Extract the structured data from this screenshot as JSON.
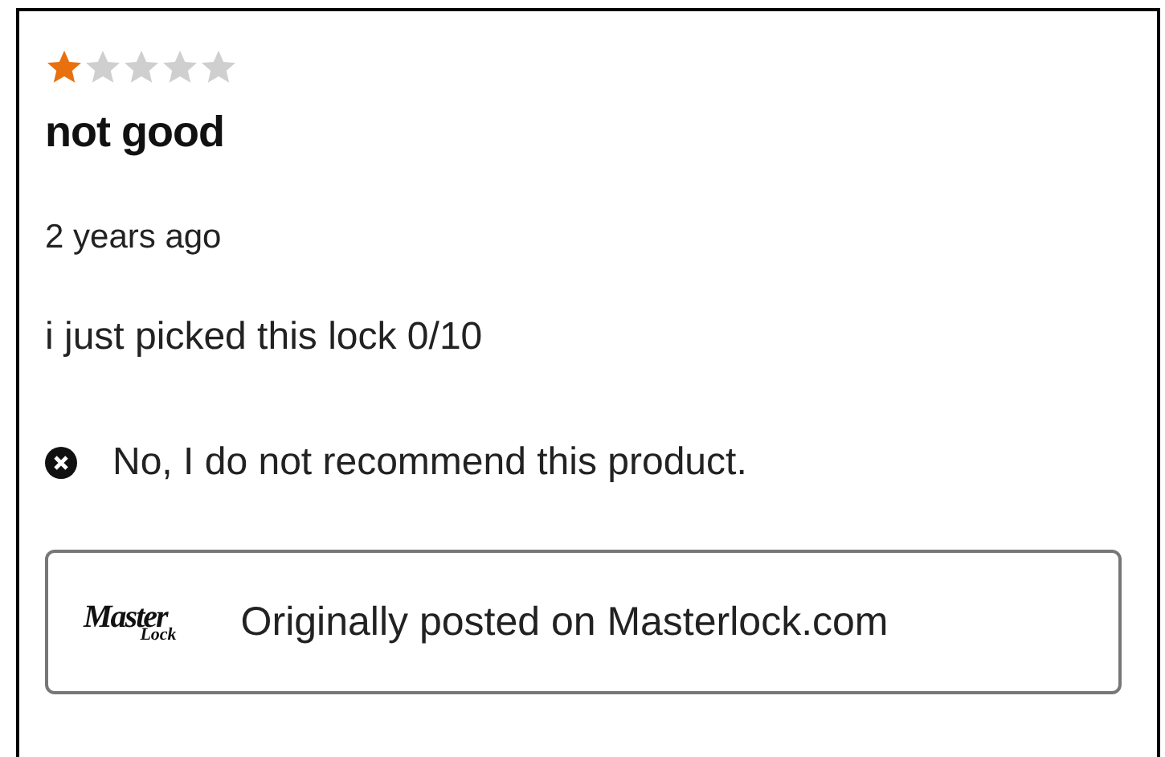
{
  "review": {
    "stars": 1,
    "title": "not good",
    "date": "2 years ago",
    "body": "i just picked this lock 0/10",
    "recommendation": {
      "recommended": false,
      "text": "No, I do not recommend this product."
    },
    "source": {
      "logo_word_1": "Master",
      "logo_word_2": "Lock",
      "text": "Originally posted on Masterlock.com"
    }
  }
}
